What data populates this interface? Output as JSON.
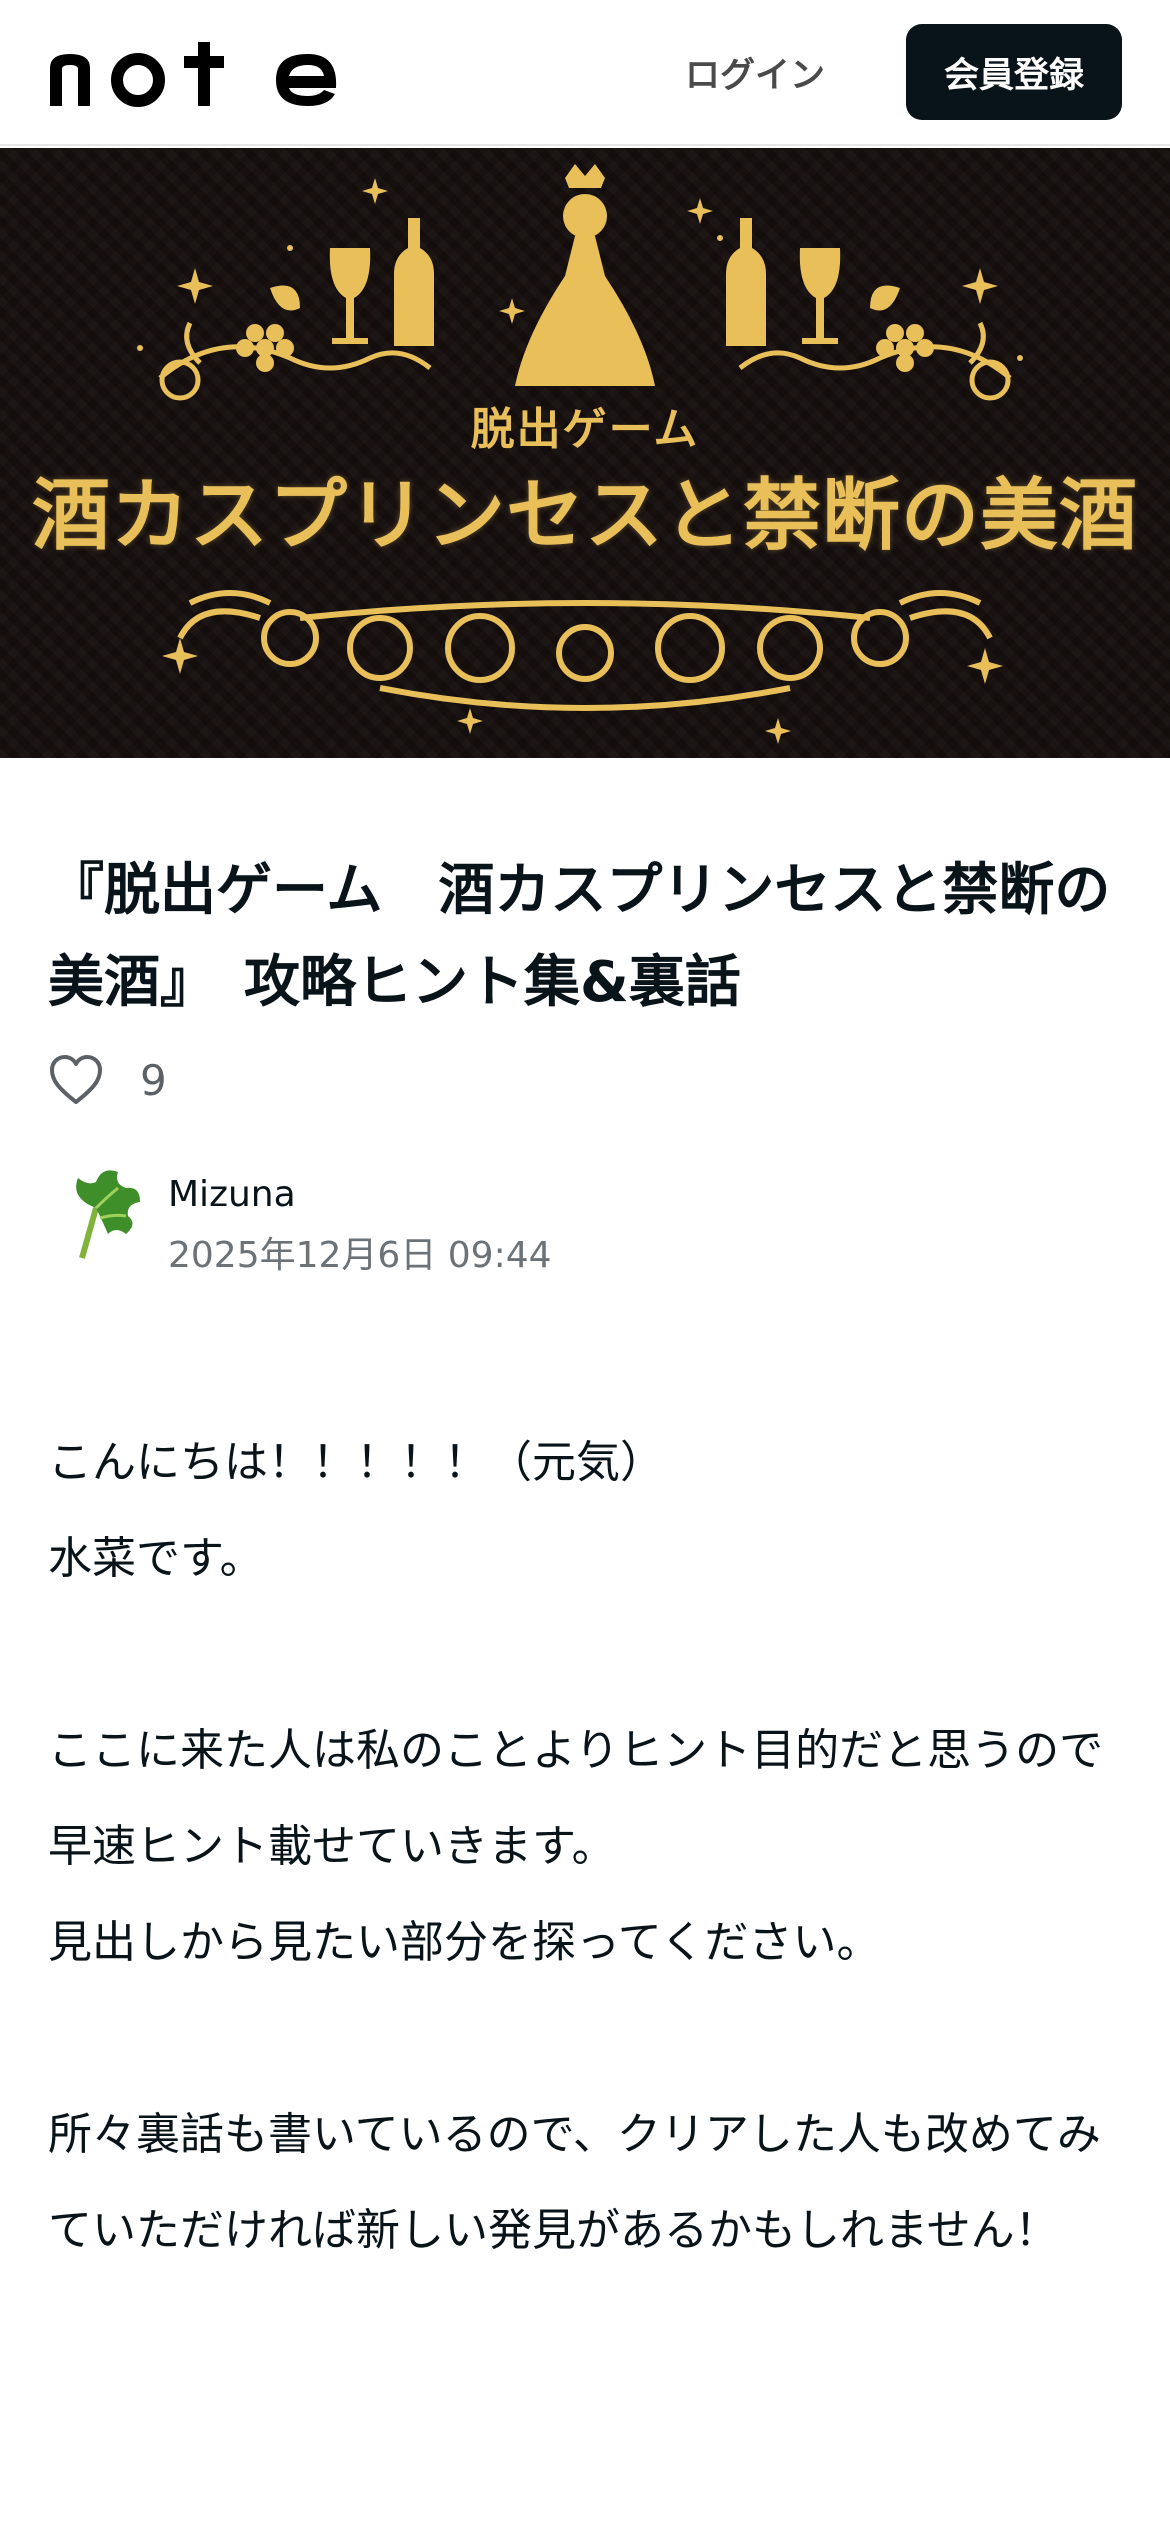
{
  "header": {
    "logo_text": "note",
    "login_label": "ログイン",
    "signup_label": "会員登録"
  },
  "hero": {
    "subtitle": "脱出ゲーム",
    "title": "酒カスプリンセスと禁断の美酒",
    "colors": {
      "background": "#17100f",
      "gold": "#e9bf5a"
    }
  },
  "article": {
    "title": "『脱出ゲーム　酒カスプリンセスと禁断の美酒』　攻略ヒント集&裏話",
    "like_count": "9",
    "author": {
      "name": "Mizuna",
      "date": "2025年12月6日 09:44",
      "avatar_icon": "leaf-avatar-icon"
    },
    "paragraphs": [
      [
        "こんにちは！！！！！（元気）",
        "水菜です。"
      ],
      [
        "ここに来た人は私のことよりヒント目的だと思うので早速ヒント載せていきます。",
        "見出しから見たい部分を探ってください。"
      ],
      [
        "所々裏話も書いているので、クリアした人も改めてみていただければ新しい発見があるかもしれません！"
      ]
    ]
  }
}
